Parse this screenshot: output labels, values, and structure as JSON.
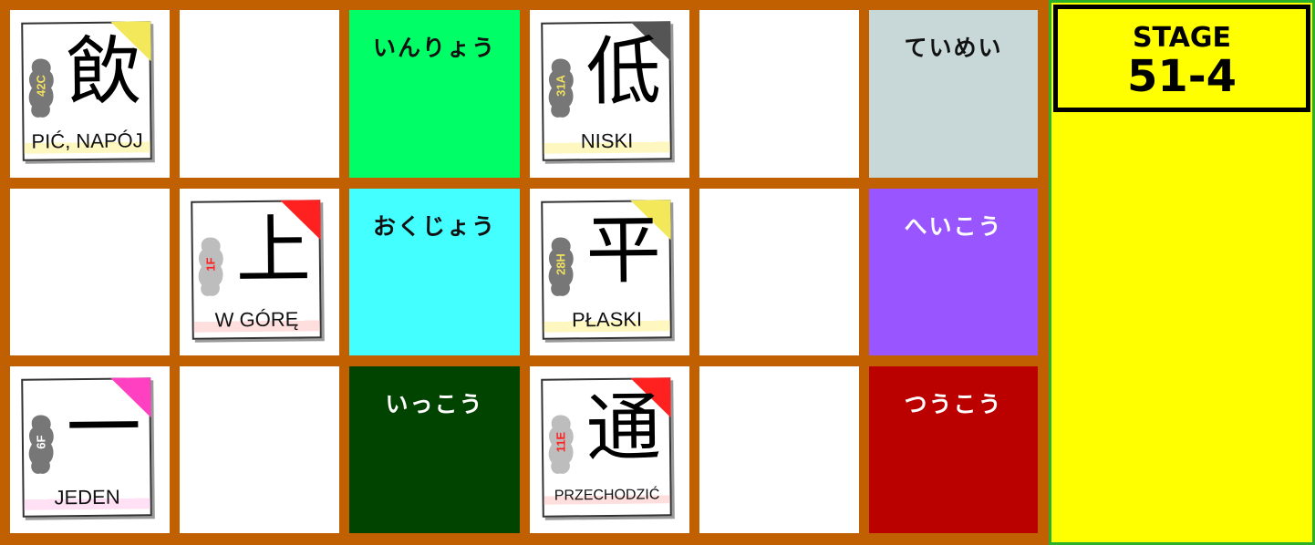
{
  "stage": {
    "label": "STAGE",
    "number": "51-4"
  },
  "cards": [
    {
      "kanji": "飲",
      "code": "42C",
      "code_color": "#f0e060",
      "meaning": "PIĆ, NAPÓJ",
      "meaning_bg": "#fff7c0",
      "corner_color": "#f2e85a"
    },
    {
      "kanji": "低",
      "code": "31A",
      "code_color": "#f0e060",
      "meaning": "NISKI",
      "meaning_bg": "#fff7c0",
      "corner_color": "#555555"
    },
    {
      "kanji": "上",
      "code": "1F",
      "code_color": "#ff2020",
      "meaning": "W GÓRĘ",
      "meaning_bg": "#ffdede",
      "corner_color": "#ff2020"
    },
    {
      "kanji": "平",
      "code": "28H",
      "code_color": "#f0e060",
      "meaning": "PŁASKI",
      "meaning_bg": "#fff7c0",
      "corner_color": "#f2e85a"
    },
    {
      "kanji": "一",
      "code": "6F",
      "code_color": "#ffffff",
      "meaning": "JEDEN",
      "meaning_bg": "#ffe0f4",
      "corner_color": "#ff40c0"
    },
    {
      "kanji": "通",
      "code": "11E",
      "code_color": "#ff2020",
      "meaning": "PRZECHODZIĆ",
      "meaning_bg": "#ffdede",
      "corner_color": "#ff2020"
    }
  ],
  "words": [
    {
      "text": "いんりょう",
      "bg": "#00ff66"
    },
    {
      "text": "ていめい",
      "bg": "#c8d8d8"
    },
    {
      "text": "おくじょう",
      "bg": "#44ffff"
    },
    {
      "text": "へいこう",
      "bg": "#9955ff"
    },
    {
      "text": "いっこう",
      "bg": "#004400"
    },
    {
      "text": "つうこう",
      "bg": "#bb0000"
    }
  ],
  "colors": {
    "board": "#c06000",
    "panel": "#ffff00",
    "panel_border": "#2ab02a"
  }
}
